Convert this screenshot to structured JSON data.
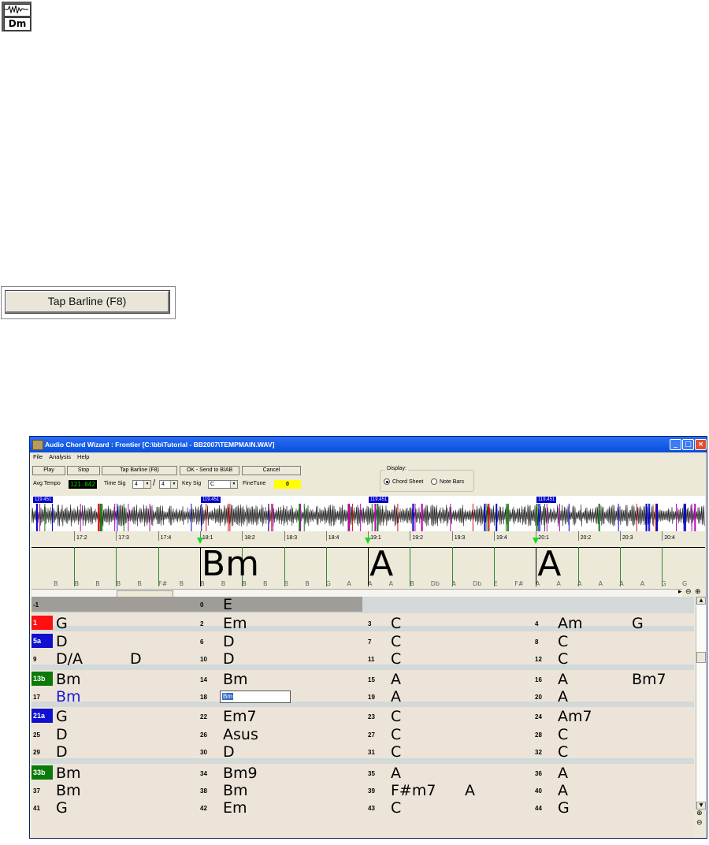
{
  "top_icon": {
    "label": "Dm"
  },
  "tap_button_large": {
    "label": "Tap Barline (F8)"
  },
  "window": {
    "title": "Audio Chord Wizard : Frontier [C:\\bb\\Tutorial - BB2007\\TEMPMAIN.WAV]",
    "controls": [
      "_",
      "□",
      "×"
    ]
  },
  "menu": [
    "File",
    "Analysis",
    "Help"
  ],
  "toolbar": {
    "play": "Play",
    "stop": "Stop",
    "tap": "Tap Barline (F8)",
    "ok": "OK - Send to BIAB",
    "cancel": "Cancel",
    "avg_tempo_label": "Avg Tempo",
    "avg_tempo_value": "121.042",
    "time_sig_label": "Time Sig",
    "time_sig_num": "4",
    "time_sig_slash": "/",
    "time_sig_den": "4",
    "key_sig_label": "Key Sig",
    "key_sig_value": "C",
    "finetune_label": "FineTune",
    "finetune_value": "0"
  },
  "display": {
    "legend": "Display:",
    "option1": "Chord Sheet",
    "option2": "Note Bars",
    "selected": "Chord Sheet"
  },
  "waveform": {
    "tempo_markers": [
      "119.451",
      "119.451",
      "119.451",
      "119.451"
    ]
  },
  "timeline": {
    "beats": [
      "17:2",
      "17:3",
      "17:4",
      "18:1",
      "18:2",
      "18:3",
      "18:4",
      "19:1",
      "19:2",
      "19:3",
      "19:4",
      "20:1",
      "20:2",
      "20:3",
      "20:4"
    ],
    "chords": [
      "Bm",
      "A",
      "A"
    ],
    "notes": [
      "B",
      "B",
      "B",
      "B",
      "B",
      "F#",
      "B",
      "B",
      "B",
      "B",
      "B",
      "B",
      "B",
      "G",
      "A",
      "A",
      "A",
      "B",
      "Db",
      "A",
      "Db",
      "E",
      "F#",
      "A",
      "A",
      "A",
      "A",
      "A",
      "A",
      "G",
      "G"
    ]
  },
  "chord_sheet": {
    "rows": [
      {
        "cells": [
          {
            "num": "-1",
            "chords": [
              ""
            ]
          },
          {
            "num": "0",
            "chords": [
              "E"
            ]
          }
        ]
      },
      {
        "cells": [
          {
            "num": "1",
            "tag": "1",
            "tag_color": "#ff1010",
            "chords": [
              "G"
            ]
          },
          {
            "num": "2",
            "chords": [
              "Em"
            ]
          },
          {
            "num": "3",
            "chords": [
              "C"
            ]
          },
          {
            "num": "4",
            "chords": [
              "Am",
              "G"
            ]
          }
        ]
      },
      {
        "cells": [
          {
            "num": "5a",
            "tag": "5a",
            "tag_color": "#1010d0",
            "chords": [
              "D"
            ]
          },
          {
            "num": "6",
            "chords": [
              "D"
            ]
          },
          {
            "num": "7",
            "chords": [
              "C"
            ]
          },
          {
            "num": "8",
            "chords": [
              "C"
            ]
          }
        ]
      },
      {
        "cells": [
          {
            "num": "9",
            "chords": [
              "D/A",
              "D"
            ]
          },
          {
            "num": "10",
            "chords": [
              "D"
            ]
          },
          {
            "num": "11",
            "chords": [
              "C"
            ]
          },
          {
            "num": "12",
            "chords": [
              "C"
            ]
          }
        ]
      },
      {
        "cells": [
          {
            "num": "13b",
            "tag": "13b",
            "tag_color": "#0a7a0a",
            "chords": [
              "Bm"
            ]
          },
          {
            "num": "14",
            "chords": [
              "Bm"
            ]
          },
          {
            "num": "15",
            "chords": [
              "A"
            ]
          },
          {
            "num": "16",
            "chords": [
              "A",
              "Bm7"
            ]
          }
        ]
      },
      {
        "cells": [
          {
            "num": "17",
            "chords": [
              "Bm"
            ]
          },
          {
            "num": "18",
            "input": "Bm"
          },
          {
            "num": "19",
            "chords": [
              "A"
            ]
          },
          {
            "num": "20",
            "chords": [
              "A"
            ]
          }
        ]
      },
      {
        "cells": [
          {
            "num": "21a",
            "tag": "21a",
            "tag_color": "#1010d0",
            "chords": [
              "G"
            ]
          },
          {
            "num": "22",
            "chords": [
              "Em7"
            ]
          },
          {
            "num": "23",
            "chords": [
              "C"
            ]
          },
          {
            "num": "24",
            "chords": [
              "Am7"
            ]
          }
        ]
      },
      {
        "cells": [
          {
            "num": "25",
            "chords": [
              "D"
            ]
          },
          {
            "num": "26",
            "chords": [
              "Asus"
            ]
          },
          {
            "num": "27",
            "chords": [
              "C"
            ]
          },
          {
            "num": "28",
            "chords": [
              "C"
            ]
          }
        ]
      },
      {
        "cells": [
          {
            "num": "29",
            "chords": [
              "D"
            ]
          },
          {
            "num": "30",
            "chords": [
              "D"
            ]
          },
          {
            "num": "31",
            "chords": [
              "C"
            ]
          },
          {
            "num": "32",
            "chords": [
              "C"
            ]
          }
        ]
      },
      {
        "cells": [
          {
            "num": "33b",
            "tag": "33b",
            "tag_color": "#0a7a0a",
            "chords": [
              "Bm"
            ]
          },
          {
            "num": "34",
            "chords": [
              "Bm9"
            ]
          },
          {
            "num": "35",
            "chords": [
              "A"
            ]
          },
          {
            "num": "36",
            "chords": [
              "A"
            ]
          }
        ]
      },
      {
        "cells": [
          {
            "num": "37",
            "chords": [
              "Bm"
            ]
          },
          {
            "num": "38",
            "chords": [
              "Bm"
            ]
          },
          {
            "num": "39",
            "chords": [
              "F#m7",
              "A"
            ]
          },
          {
            "num": "40",
            "chords": [
              "A"
            ]
          }
        ]
      },
      {
        "cells": [
          {
            "num": "41",
            "chords": [
              "G"
            ]
          },
          {
            "num": "42",
            "chords": [
              "Em"
            ]
          },
          {
            "num": "43",
            "chords": [
              "C"
            ]
          },
          {
            "num": "44",
            "chords": [
              "G"
            ]
          }
        ]
      }
    ]
  },
  "colors": {
    "selected_chord_text": "#1a1ad0",
    "input_highlight": "#316ac5",
    "finetune_bg": "#ffff00",
    "lcd_fg": "#00d800"
  }
}
